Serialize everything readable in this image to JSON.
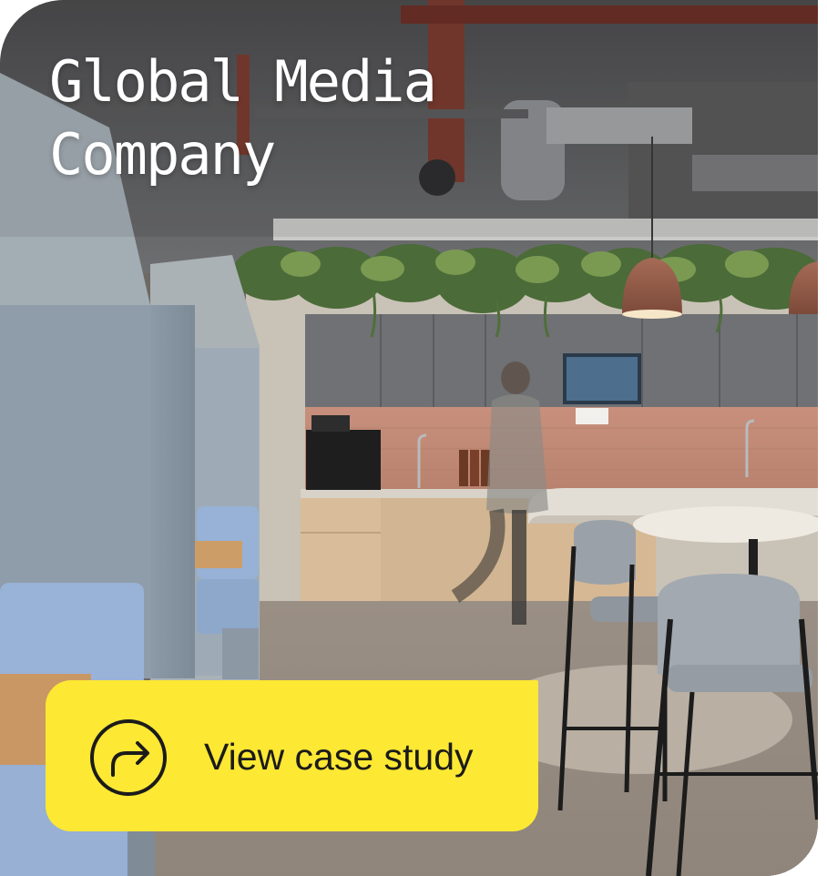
{
  "card": {
    "title": "Global Media Company",
    "title_line1": "Global Media",
    "title_line2": "Company"
  },
  "cta": {
    "label": "View case study",
    "icon": "arrow-turn-icon",
    "color": "#fde833"
  },
  "photo": {
    "icon": "office-kitchen-photo"
  }
}
